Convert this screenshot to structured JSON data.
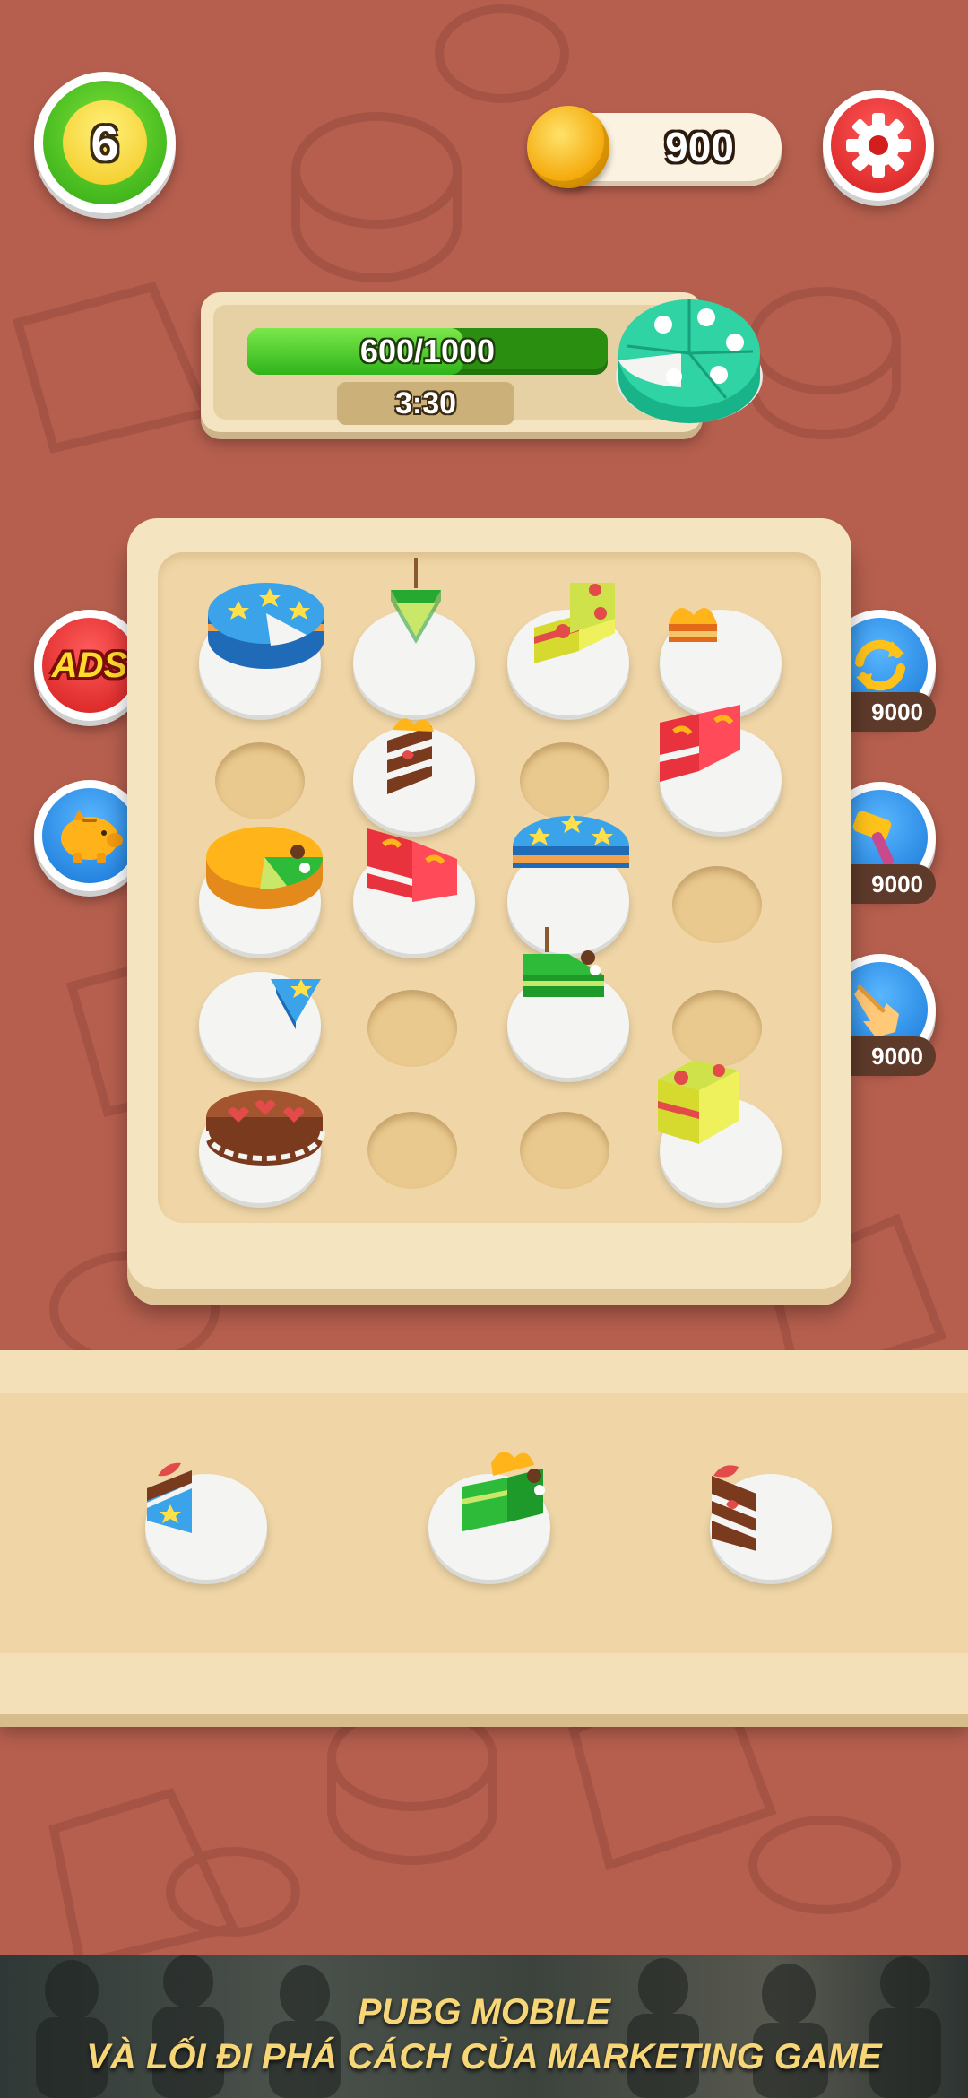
{
  "hud": {
    "level": "6",
    "coins": "900"
  },
  "progress": {
    "label": "600/1000",
    "fraction": 0.6,
    "timer": "3:30"
  },
  "side_buttons": {
    "ads_label": "ADS"
  },
  "boosters": [
    {
      "icon": "shuffle-icon",
      "price": "9000"
    },
    {
      "icon": "hammer-icon",
      "price": "9000"
    },
    {
      "icon": "tap-hand-icon",
      "price": "9000"
    }
  ],
  "colors": {
    "background": "#b65f4e",
    "board": "#f5e4c0",
    "accent_red": "#d41e1e",
    "progress_green": "#2fb41a",
    "coin_gold": "#f3a300"
  },
  "banner": {
    "line1": "PUBG MOBILE",
    "line2": "VÀ LỐI ĐI PHÁ CÁCH CỦA MARKETING GAME"
  }
}
